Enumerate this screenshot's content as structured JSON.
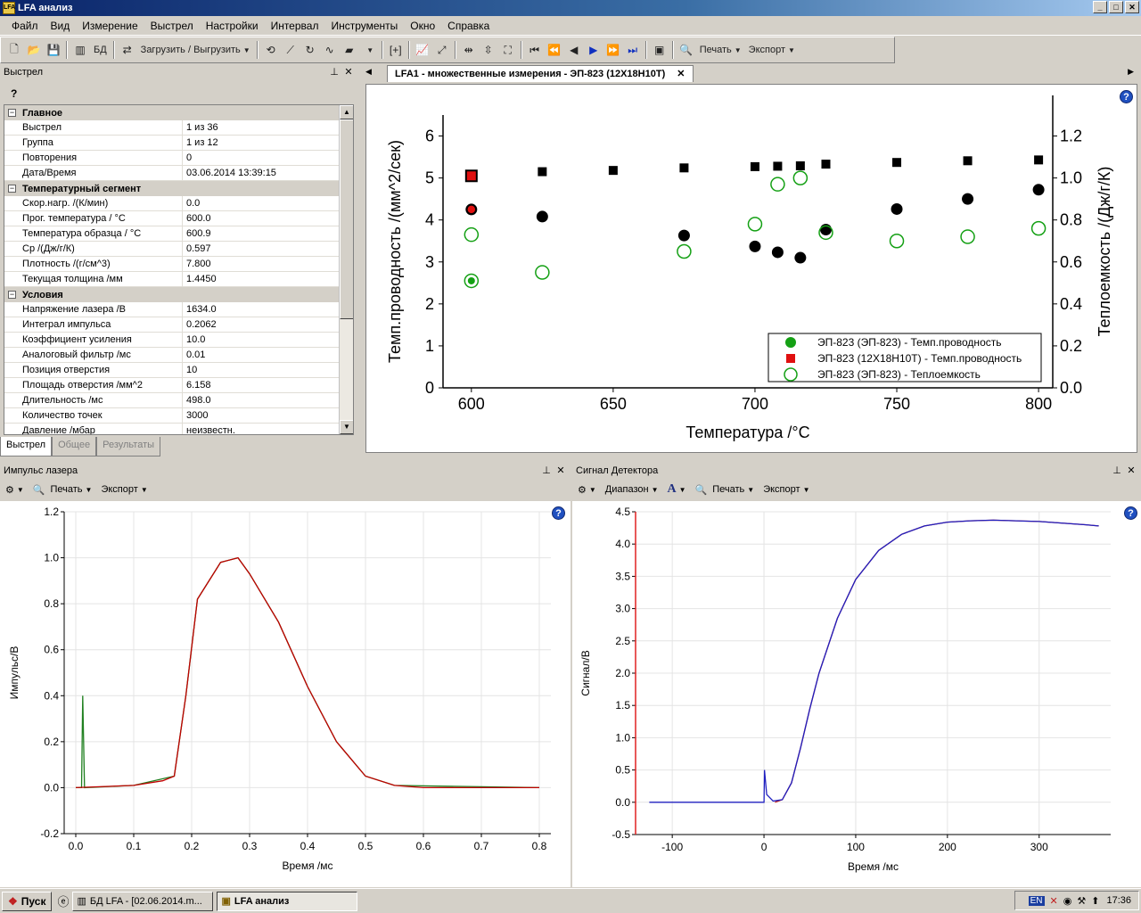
{
  "window": {
    "title": "LFA анализ",
    "min": "_",
    "max": "□",
    "close": "✕"
  },
  "menu": [
    "Файл",
    "Вид",
    "Измерение",
    "Выстрел",
    "Настройки",
    "Интервал",
    "Инструменты",
    "Окно",
    "Справка"
  ],
  "toolbar": {
    "db": "БД",
    "load": "Загрузить / Выгрузить",
    "print": "Печать",
    "export": "Экспорт"
  },
  "left_panel": {
    "title": "Выстрел",
    "help": "?",
    "sections": [
      {
        "name": "Главное",
        "rows": [
          [
            "Выстрел",
            "1 из 36"
          ],
          [
            "Группа",
            "1 из 12"
          ],
          [
            "Повторения",
            "0"
          ],
          [
            "Дата/Время",
            "03.06.2014 13:39:15"
          ]
        ]
      },
      {
        "name": "Температурный сегмент",
        "rows": [
          [
            "Скор.нагр. /(К/мин)",
            "0.0"
          ],
          [
            "Прог. температура / °C",
            "600.0"
          ],
          [
            "Температура образца / °C",
            "600.9"
          ],
          [
            "Cp /(Дж/г/К)",
            "0.597"
          ],
          [
            "Плотность /(г/см^3)",
            "7.800"
          ],
          [
            "Текущая толщина /мм",
            "1.4450"
          ]
        ]
      },
      {
        "name": "Условия",
        "rows": [
          [
            "Напряжение лазера /В",
            "1634.0"
          ],
          [
            "Интеграл импульса",
            "0.2062"
          ],
          [
            "Коэффициент усиления",
            "10.0"
          ],
          [
            "Аналоговый фильтр /мс",
            "0.01"
          ],
          [
            "Позиция отверстия",
            "10"
          ],
          [
            "Площадь отверстия /мм^2",
            "6.158"
          ],
          [
            "Длительность /мс",
            "498.0"
          ],
          [
            "Количество точек",
            "3000"
          ],
          [
            "Давление /мбар",
            "неизвестн."
          ]
        ]
      }
    ],
    "tabs": [
      "Выстрел",
      "Общее",
      "Результаты"
    ]
  },
  "doc_tab": "LFA1 - множественные измерения - ЭП-823 (12Х18Н10Т)",
  "chart_data": [
    {
      "type": "scatter",
      "xlabel": "Температура /°C",
      "ylabel": "Темп.проводность /(мм^2/сек)",
      "y2label": "Теплоемкость /(Дж/г/К)",
      "xlim": [
        590,
        805
      ],
      "ylim": [
        0,
        6.5
      ],
      "y2lim": [
        0,
        1.3
      ],
      "xticks": [
        600,
        650,
        700,
        750,
        800
      ],
      "yticks": [
        0,
        1,
        2,
        3,
        4,
        5,
        6
      ],
      "y2ticks": [
        0.0,
        0.2,
        0.4,
        0.6,
        0.8,
        1.0,
        1.2
      ],
      "legend_position": "bottom-right",
      "series": [
        {
          "name": "ЭП-823 (ЭП-823) - Темп.проводность",
          "marker": "circle",
          "color": "#000000",
          "legend_color": "#14a014",
          "points": [
            [
              600,
              4.25
            ],
            [
              625,
              4.08
            ],
            [
              675,
              3.63
            ],
            [
              700,
              3.37
            ],
            [
              708,
              3.23
            ],
            [
              716,
              3.1
            ],
            [
              725,
              3.77
            ],
            [
              750,
              4.26
            ],
            [
              775,
              4.5
            ],
            [
              800,
              4.72
            ]
          ]
        },
        {
          "name": "ЭП-823 (12Х18Н10Т) - Темп.проводность",
          "marker": "square",
          "color": "#000000",
          "legend_color": "#e01010",
          "points": [
            [
              600,
              5.05
            ],
            [
              625,
              5.15
            ],
            [
              650,
              5.18
            ],
            [
              675,
              5.24
            ],
            [
              700,
              5.27
            ],
            [
              708,
              5.28
            ],
            [
              716,
              5.29
            ],
            [
              725,
              5.33
            ],
            [
              750,
              5.37
            ],
            [
              775,
              5.41
            ],
            [
              800,
              5.43
            ]
          ]
        },
        {
          "name": "ЭП-823 (ЭП-823) - Теплоемкость",
          "marker": "open-circle",
          "color": "#14a014",
          "axis": "y2",
          "points": [
            [
              600,
              0.73
            ],
            [
              600,
              0.51
            ],
            [
              625,
              0.55
            ],
            [
              675,
              0.65
            ],
            [
              700,
              0.78
            ],
            [
              708,
              0.97
            ],
            [
              716,
              1.0
            ],
            [
              725,
              0.74
            ],
            [
              750,
              0.7
            ],
            [
              775,
              0.72
            ],
            [
              800,
              0.76
            ]
          ]
        }
      ]
    },
    {
      "type": "line",
      "title": "Импульс лазера",
      "xlabel": "Время /мс",
      "ylabel": "Импульс/В",
      "xlim": [
        -0.02,
        0.82
      ],
      "ylim": [
        -0.2,
        1.2
      ],
      "xticks": [
        0.0,
        0.1,
        0.2,
        0.3,
        0.4,
        0.5,
        0.6,
        0.7,
        0.8
      ],
      "yticks": [
        -0.2,
        0.0,
        0.2,
        0.4,
        0.6,
        0.8,
        1.0,
        1.2
      ],
      "series": [
        {
          "name": "",
          "color": "#c00000",
          "x": [
            0,
            0.1,
            0.15,
            0.17,
            0.19,
            0.21,
            0.25,
            0.28,
            0.3,
            0.35,
            0.4,
            0.45,
            0.5,
            0.55,
            0.6,
            0.8
          ],
          "y": [
            0,
            0.01,
            0.03,
            0.05,
            0.4,
            0.82,
            0.98,
            1.0,
            0.93,
            0.72,
            0.44,
            0.2,
            0.05,
            0.01,
            0,
            0
          ]
        },
        {
          "name": "",
          "color": "#208020",
          "x": [
            0,
            0.01,
            0.012,
            0.015,
            0.1,
            0.17,
            0.19,
            0.21,
            0.25,
            0.28,
            0.3,
            0.35,
            0.4,
            0.45,
            0.5,
            0.55,
            0.8
          ],
          "y": [
            0,
            0,
            0.4,
            0,
            0.01,
            0.05,
            0.4,
            0.82,
            0.98,
            1.0,
            0.93,
            0.72,
            0.44,
            0.2,
            0.05,
            0.01,
            0
          ]
        }
      ]
    },
    {
      "type": "line",
      "title": "Сигнал Детектора",
      "xlabel": "Время /мс",
      "ylabel": "Сигнал/В",
      "xlim": [
        -140,
        378
      ],
      "ylim": [
        -0.5,
        4.5
      ],
      "xticks": [
        -100,
        0,
        100,
        200,
        300
      ],
      "yticks": [
        -0.5,
        0.0,
        0.5,
        1.0,
        1.5,
        2.0,
        2.5,
        3.0,
        3.5,
        4.0,
        4.5
      ],
      "series": [
        {
          "name": "",
          "color": "#2020c0",
          "x": [
            -125,
            -20,
            -5,
            0,
            0.5,
            3,
            10,
            20,
            30,
            40,
            50,
            60,
            80,
            100,
            125,
            150,
            175,
            200,
            225,
            250,
            300,
            350,
            365
          ],
          "y": [
            0,
            0,
            0,
            0,
            0.5,
            0.12,
            0.02,
            0.04,
            0.3,
            0.85,
            1.45,
            2.0,
            2.85,
            3.45,
            3.9,
            4.15,
            4.28,
            4.34,
            4.36,
            4.37,
            4.35,
            4.3,
            4.28
          ]
        },
        {
          "name": "",
          "color": "#c02020",
          "x": [
            12,
            20,
            30,
            40,
            50,
            60,
            80,
            100,
            125,
            150,
            175,
            200,
            225,
            250,
            300,
            350,
            365
          ],
          "y": [
            0,
            0.04,
            0.3,
            0.85,
            1.45,
            2.0,
            2.85,
            3.45,
            3.9,
            4.15,
            4.28,
            4.34,
            4.36,
            4.37,
            4.35,
            4.3,
            4.28
          ]
        }
      ]
    }
  ],
  "pulse_panel": {
    "title": "Импульс лазера",
    "print": "Печать",
    "export": "Экспорт"
  },
  "detector_panel": {
    "title": "Сигнал Детектора",
    "range": "Диапазон",
    "font": "A",
    "print": "Печать",
    "export": "Экспорт"
  },
  "taskbar": {
    "start": "Пуск",
    "tasks": [
      "БД LFA - [02.06.2014.m...",
      "LFA анализ"
    ],
    "lang": "EN",
    "clock": "17:36"
  }
}
